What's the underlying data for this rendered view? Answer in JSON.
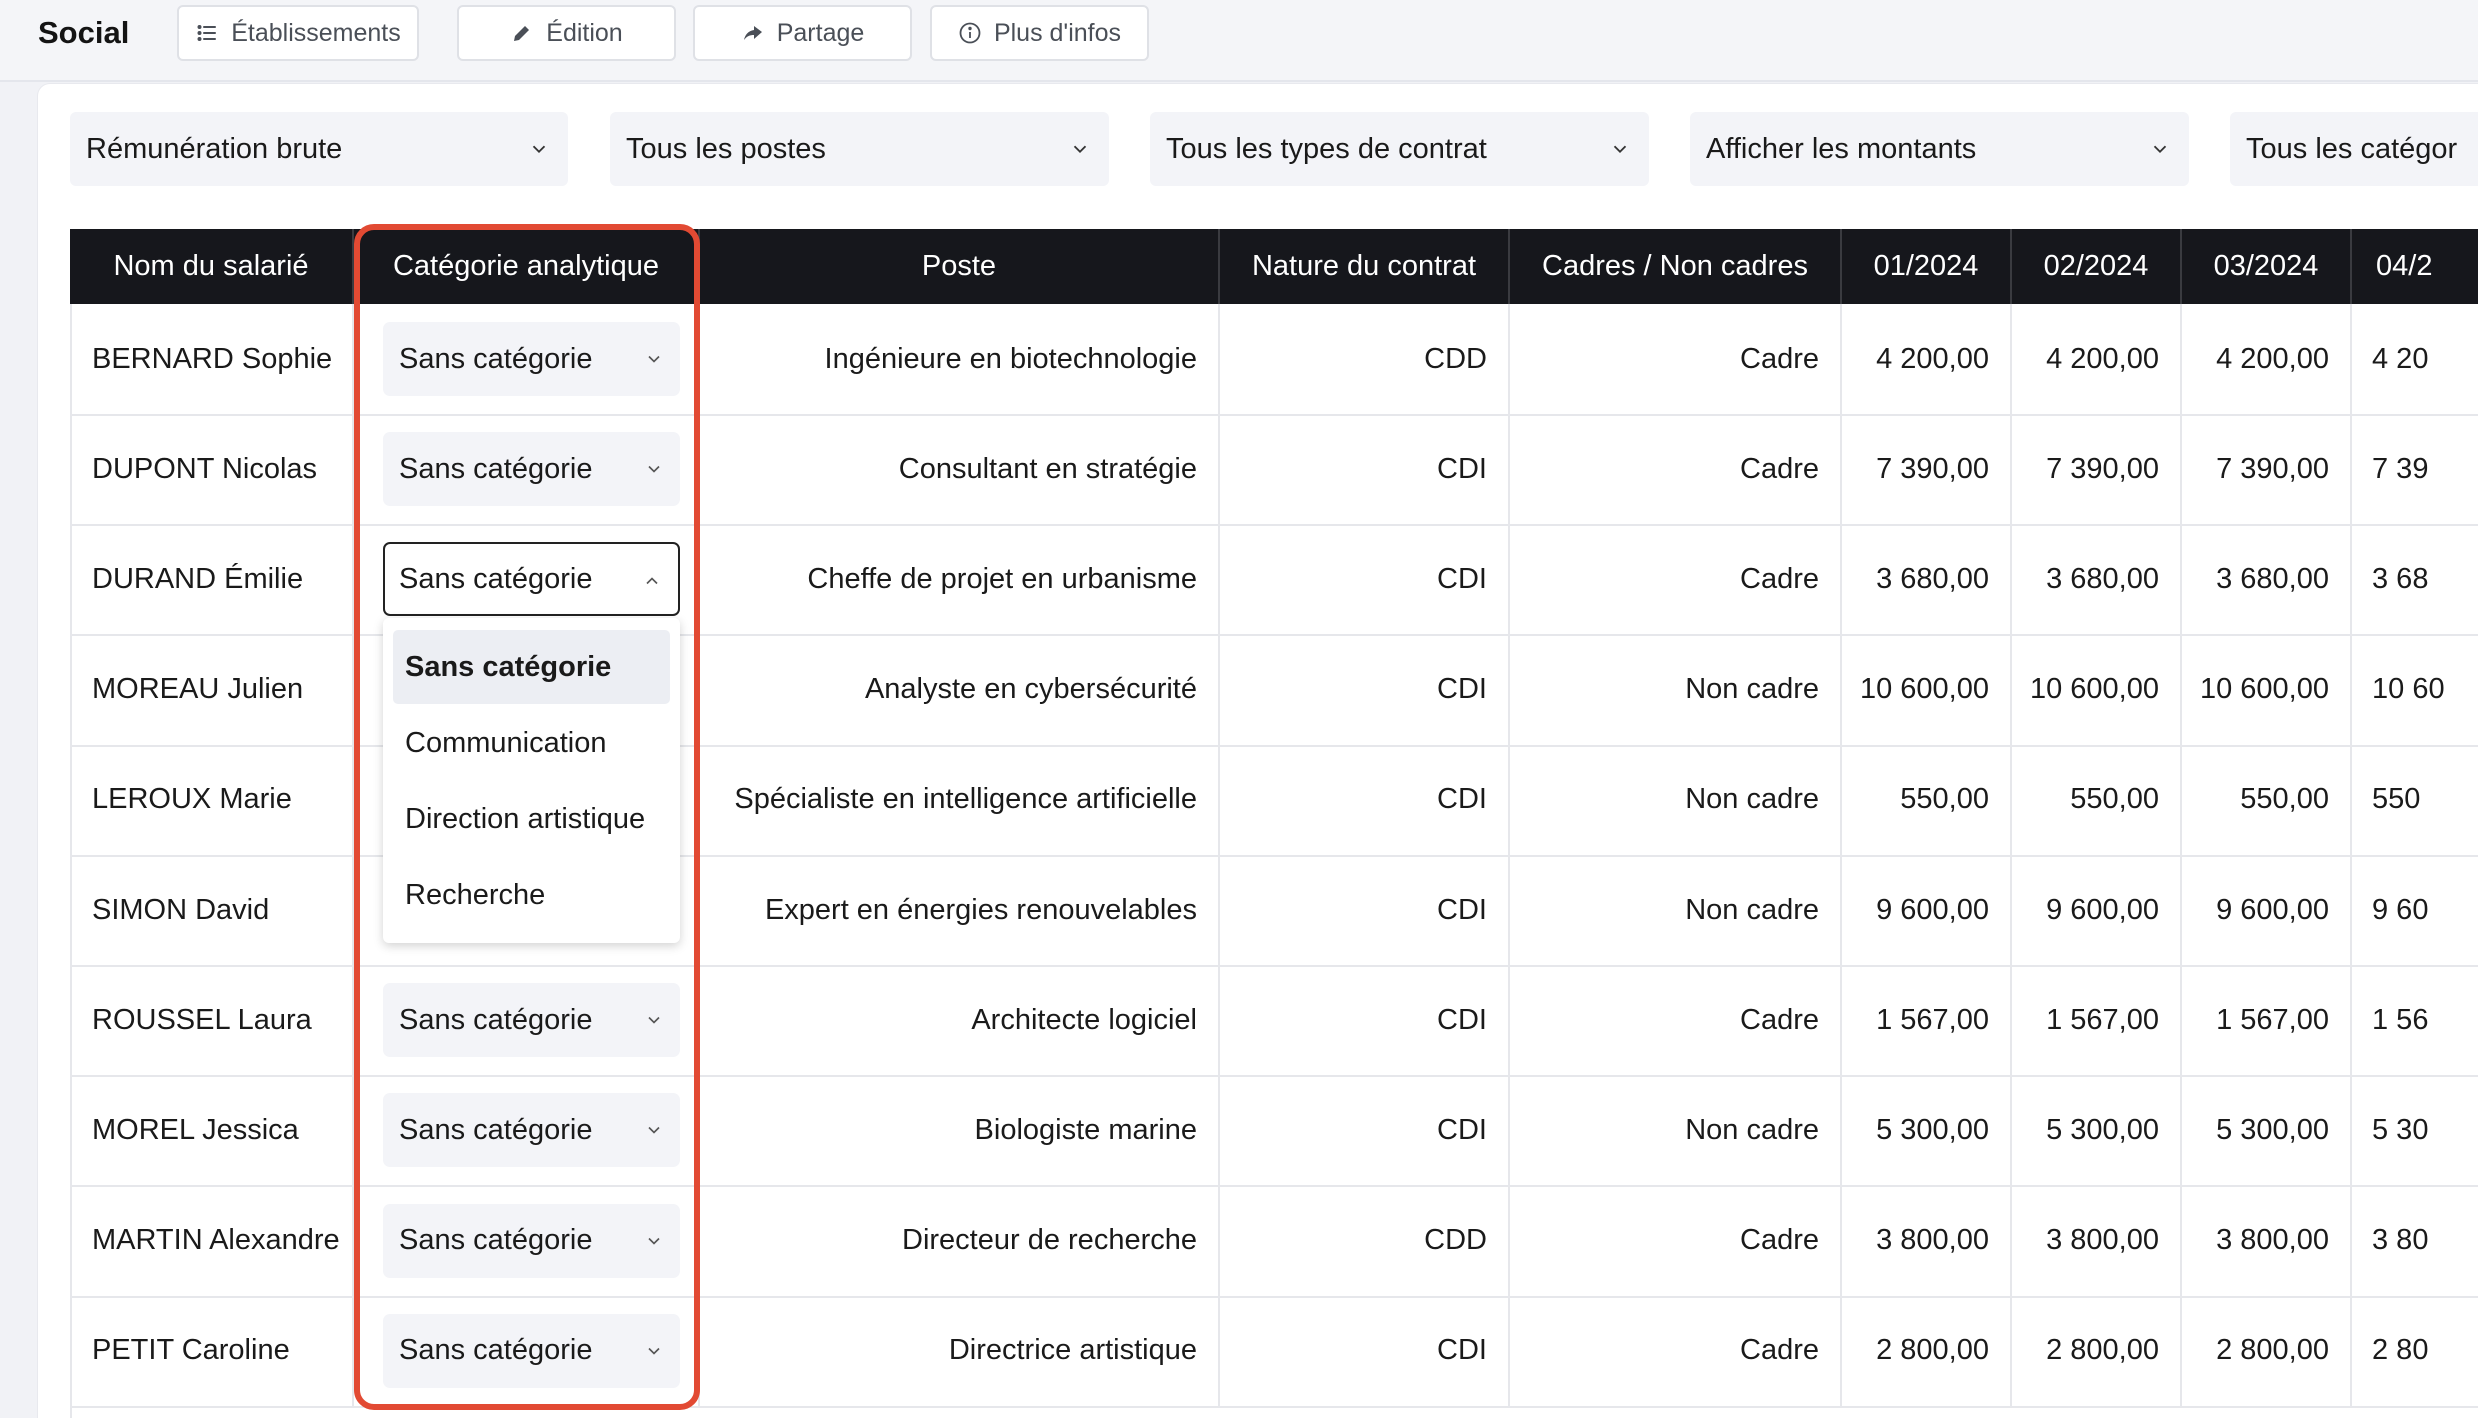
{
  "app": {
    "title": "Social"
  },
  "toolbar": {
    "etablissements": "Établissements",
    "edition": "Édition",
    "partage": "Partage",
    "plus_infos": "Plus d'infos"
  },
  "filters": {
    "remuneration": "Rémunération brute",
    "postes": "Tous les postes",
    "types_contrat": "Tous les types de contrat",
    "montants": "Afficher les montants",
    "categories": "Tous les catégor"
  },
  "table": {
    "headers": {
      "nom": "Nom du salarié",
      "categorie": "Catégorie analytique",
      "poste": "Poste",
      "nature": "Nature du contrat",
      "cadres": "Cadres / Non cadres",
      "m1": "01/2024",
      "m2": "02/2024",
      "m3": "03/2024",
      "m4": "04/2"
    },
    "rows": [
      {
        "nom": "BERNARD Sophie",
        "categorie": "Sans catégorie",
        "poste": "Ingénieure en biotechnologie",
        "nature": "CDD",
        "cadre": "Cadre",
        "m1": "4 200,00",
        "m2": "4 200,00",
        "m3": "4 200,00",
        "m4": "4 20"
      },
      {
        "nom": "DUPONT Nicolas",
        "categorie": "Sans catégorie",
        "poste": "Consultant en stratégie",
        "nature": "CDI",
        "cadre": "Cadre",
        "m1": "7 390,00",
        "m2": "7 390,00",
        "m3": "7 390,00",
        "m4": "7 39"
      },
      {
        "nom": "DURAND Émilie",
        "categorie": "Sans catégorie",
        "poste": "Cheffe de projet en urbanisme",
        "nature": "CDI",
        "cadre": "Cadre",
        "m1": "3 680,00",
        "m2": "3 680,00",
        "m3": "3 680,00",
        "m4": "3 68"
      },
      {
        "nom": "MOREAU Julien",
        "categorie": "",
        "poste": "Analyste en cybersécurité",
        "nature": "CDI",
        "cadre": "Non cadre",
        "m1": "10 600,00",
        "m2": "10 600,00",
        "m3": "10 600,00",
        "m4": "10 60"
      },
      {
        "nom": "LEROUX Marie",
        "categorie": "",
        "poste": "Spécialiste en intelligence artificielle",
        "nature": "CDI",
        "cadre": "Non cadre",
        "m1": "550,00",
        "m2": "550,00",
        "m3": "550,00",
        "m4": "550"
      },
      {
        "nom": "SIMON David",
        "categorie": "",
        "poste": "Expert en énergies renouvelables",
        "nature": "CDI",
        "cadre": "Non cadre",
        "m1": "9 600,00",
        "m2": "9 600,00",
        "m3": "9 600,00",
        "m4": "9 60"
      },
      {
        "nom": "ROUSSEL Laura",
        "categorie": "Sans catégorie",
        "poste": "Architecte logiciel",
        "nature": "CDI",
        "cadre": "Cadre",
        "m1": "1 567,00",
        "m2": "1 567,00",
        "m3": "1 567,00",
        "m4": "1 56"
      },
      {
        "nom": "MOREL Jessica",
        "categorie": "Sans catégorie",
        "poste": "Biologiste marine",
        "nature": "CDI",
        "cadre": "Non cadre",
        "m1": "5 300,00",
        "m2": "5 300,00",
        "m3": "5 300,00",
        "m4": "5 30"
      },
      {
        "nom": "MARTIN Alexandre",
        "categorie": "Sans catégorie",
        "poste": "Directeur de recherche",
        "nature": "CDD",
        "cadre": "Cadre",
        "m1": "3 800,00",
        "m2": "3 800,00",
        "m3": "3 800,00",
        "m4": "3 80"
      },
      {
        "nom": "PETIT Caroline",
        "categorie": "Sans catégorie",
        "poste": "Directrice artistique",
        "nature": "CDI",
        "cadre": "Cadre",
        "m1": "2 800,00",
        "m2": "2 800,00",
        "m3": "2 800,00",
        "m4": "2 80"
      }
    ]
  },
  "dropdown": {
    "options": [
      "Sans catégorie",
      "Communication",
      "Direction artistique",
      "Recherche"
    ],
    "selected": "Sans catégorie"
  },
  "colors": {
    "highlight": "#e24a33",
    "header_bg": "#16171c",
    "filter_bg": "#f3f4f8"
  }
}
